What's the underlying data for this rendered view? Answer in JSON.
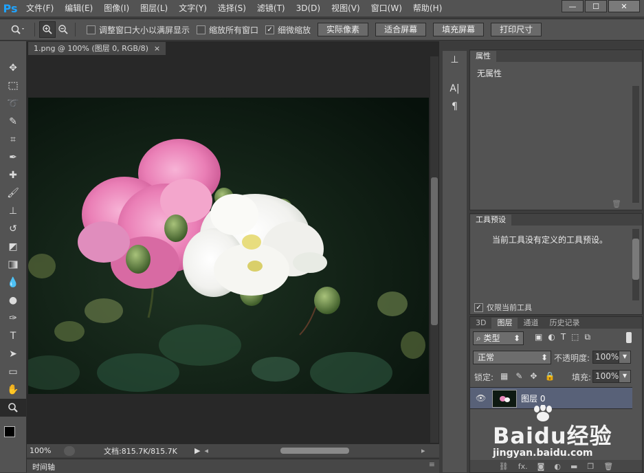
{
  "app": {
    "logo": "Ps"
  },
  "menu": [
    "文件(F)",
    "编辑(E)",
    "图像(I)",
    "图层(L)",
    "文字(Y)",
    "选择(S)",
    "滤镜(T)",
    "3D(D)",
    "视图(V)",
    "窗口(W)",
    "帮助(H)"
  ],
  "window_controls": [
    "—",
    "☐",
    "✕"
  ],
  "options": {
    "zoom_icon": "magnifier-icon",
    "check1": "调整窗口大小以满屏显示",
    "check2": "缩放所有窗口",
    "check3": "细微缩放",
    "check3_state": "✓",
    "btn_actual": "实际像素",
    "btn_fit": "适合屏幕",
    "btn_fill": "填充屏幕",
    "btn_print": "打印尺寸"
  },
  "document": {
    "tab_title": "1.png @ 100% (图层 0, RGB/8)",
    "tab_close": "×",
    "zoom": "100%",
    "doc_info": "文档:815.7K/815.7K"
  },
  "timeline": {
    "label": "时间轴"
  },
  "properties": {
    "tab": "属性",
    "content": "无属性"
  },
  "tool_presets": {
    "tab": "工具预设",
    "content": "当前工具没有定义的工具预设。",
    "only_current": "仅限当前工具",
    "only_current_state": "✓"
  },
  "layers": {
    "tabs": [
      "3D",
      "图层",
      "通道",
      "历史记录"
    ],
    "filter_label": "类型",
    "blend_mode": "正常",
    "opacity_label": "不透明度:",
    "opacity_value": "100%",
    "lock_label": "锁定:",
    "fill_label": "填充:",
    "fill_value": "100%",
    "layer_name": "图层 0",
    "footer_fx": "fx."
  },
  "watermark": {
    "brand": "Baidu经验",
    "url": "jingyan.baidu.com"
  }
}
